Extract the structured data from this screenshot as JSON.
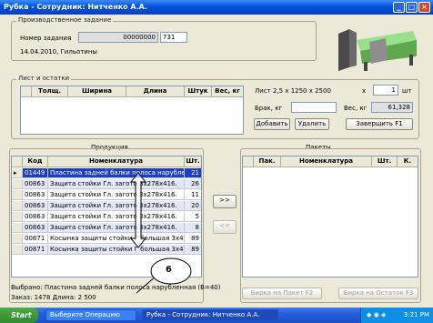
{
  "window": {
    "title": "Рубка - Сотрудник: Нитченко А.А."
  },
  "task": {
    "group_label": "Производственное задание",
    "number_label": "Номер задания",
    "number_value": "00000000",
    "number_suffix": "731",
    "date_line": "14.04.2010, Гильотины"
  },
  "sheets": {
    "group_label": "Лист и остатки",
    "columns": [
      "Толщ.",
      "Ширина",
      "Длина",
      "Штук",
      "Вес, кг"
    ],
    "sheet_desc": "Лист 2,5 х 1250 х 2500",
    "x_label": "x",
    "qty_value": "1",
    "qty_unit": "шт",
    "scrap_label": "Брак, кг",
    "scrap_value": "",
    "weight_label": "Вес, кг",
    "weight_value": "61,328",
    "add_label": "Добавить",
    "delete_label": "Удалить",
    "finish_label": "Завершить   F1"
  },
  "products": {
    "group_label": "Продукция",
    "columns": [
      "Код",
      "Номенклатура",
      "Шт."
    ],
    "rows": [
      {
        "code": "01449",
        "name": "Пластина задней балки полоса нарублен",
        "qty": "21"
      },
      {
        "code": "00863",
        "name": "Защита стойки Гл. загото     3х278х416.",
        "qty": "26"
      },
      {
        "code": "00863",
        "name": "Защита стойки Гл. загото     3х278х416.",
        "qty": "11"
      },
      {
        "code": "00863",
        "name": "Защита стойки Гл. загото     3х278х416.",
        "qty": "20"
      },
      {
        "code": "00863",
        "name": "Защита стойки Гл. загото     3х278х416.",
        "qty": "5"
      },
      {
        "code": "00863",
        "name": "Защита стойки Гл. загото     3х278х416.",
        "qty": "8"
      },
      {
        "code": "00871",
        "name": "Косынка защиты стойки Г  большая 3х40",
        "qty": "89"
      },
      {
        "code": "00871",
        "name": "Косынка защиты стойки Г  большая 3х40",
        "qty": "89"
      }
    ],
    "selected_line": "Выбрано: Пластина задней балки полоса нарубленная (B=40)",
    "order_line": "Заказ: 1478  Длина: 2 500"
  },
  "transfer": {
    "forward": ">>",
    "back": "<<"
  },
  "packets": {
    "group_label": "Пакеты",
    "columns": [
      "Пак.",
      "Номенклатура",
      "Шт.",
      "К."
    ],
    "tag_packet_label": "Бирка на Пакет   F2",
    "tag_remainder_label": "Бирка на Остаток   F3"
  },
  "annotation": {
    "callout": "6"
  },
  "taskbar": {
    "start": "Start",
    "items": [
      "Выберите Операцию",
      "Рубка - Сотрудник: Нитченко А.А."
    ],
    "clock": "3:21 PM"
  }
}
